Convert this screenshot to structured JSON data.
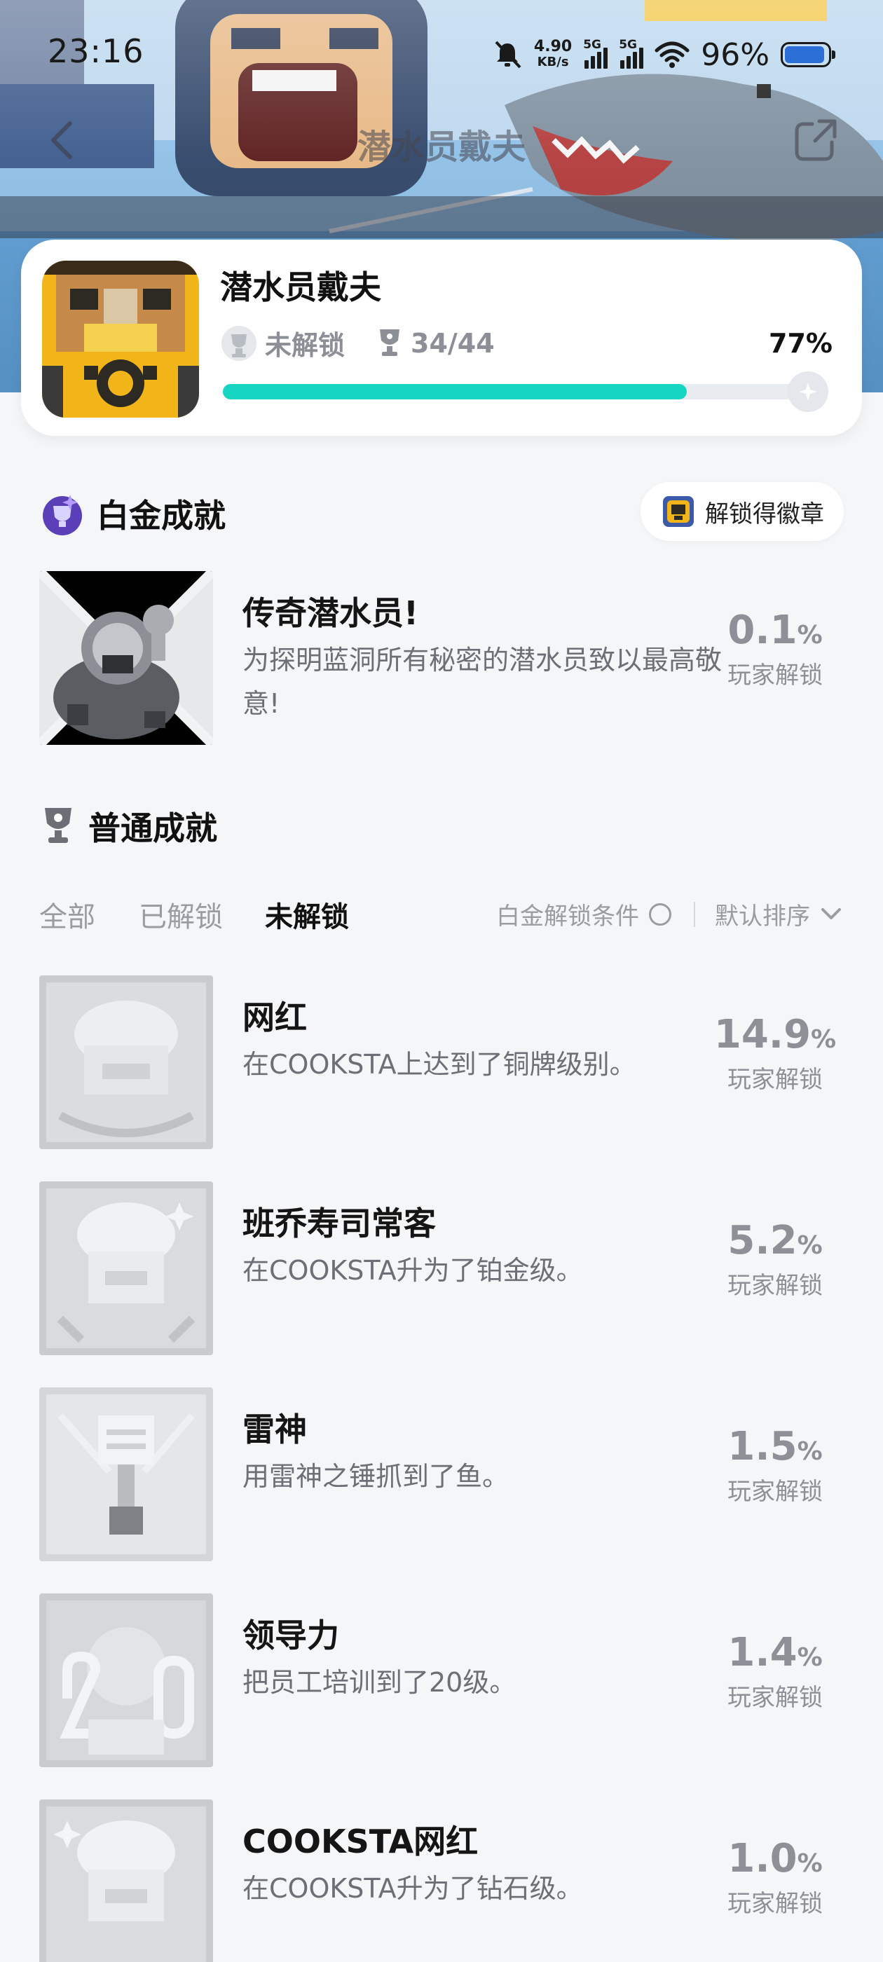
{
  "status_bar": {
    "time": "23:16",
    "net_speed_value": "4.90",
    "net_speed_unit": "KB/s",
    "signal_1": "5G",
    "signal_2": "5G",
    "battery": "96%"
  },
  "nav": {
    "title": "潜水员戴夫",
    "back_icon": "chevron-left-icon",
    "share_icon": "share-icon"
  },
  "game": {
    "name": "潜水员戴夫",
    "platinum_status": "未解锁",
    "trophy_count": "34/44",
    "completion_pct": "77%",
    "progress_fraction": 0.77
  },
  "platinum": {
    "section_title": "白金成就",
    "badge_button_label": "解锁得徽章",
    "item": {
      "name": "传奇潜水员!",
      "desc": "为探明蓝洞所有秘密的潜水员致以最高敬意!",
      "rate": "0.1",
      "rate_unit": "%",
      "rate_label": "玩家解锁"
    }
  },
  "normal": {
    "section_title": "普通成就",
    "tabs": [
      "全部",
      "已解锁",
      "未解锁"
    ],
    "active_tab": "未解锁",
    "platinum_condition_label": "白金解锁条件",
    "sort_label": "默认排序",
    "items": [
      {
        "name": "网红",
        "desc": "在COOKSTA上达到了铜牌级别。",
        "rate": "14.9",
        "rate_unit": "%",
        "rate_label": "玩家解锁"
      },
      {
        "name": "班乔寿司常客",
        "desc": "在COOKSTA升为了铂金级。",
        "rate": "5.2",
        "rate_unit": "%",
        "rate_label": "玩家解锁"
      },
      {
        "name": "雷神",
        "desc": "用雷神之锤抓到了鱼。",
        "rate": "1.5",
        "rate_unit": "%",
        "rate_label": "玩家解锁"
      },
      {
        "name": "领导力",
        "desc": "把员工培训到了20级。",
        "rate": "1.4",
        "rate_unit": "%",
        "rate_label": "玩家解锁"
      },
      {
        "name": "COOKSTA网红",
        "desc": "在COOKSTA升为了钻石级。",
        "rate": "1.0",
        "rate_unit": "%",
        "rate_label": "玩家解锁"
      }
    ]
  }
}
